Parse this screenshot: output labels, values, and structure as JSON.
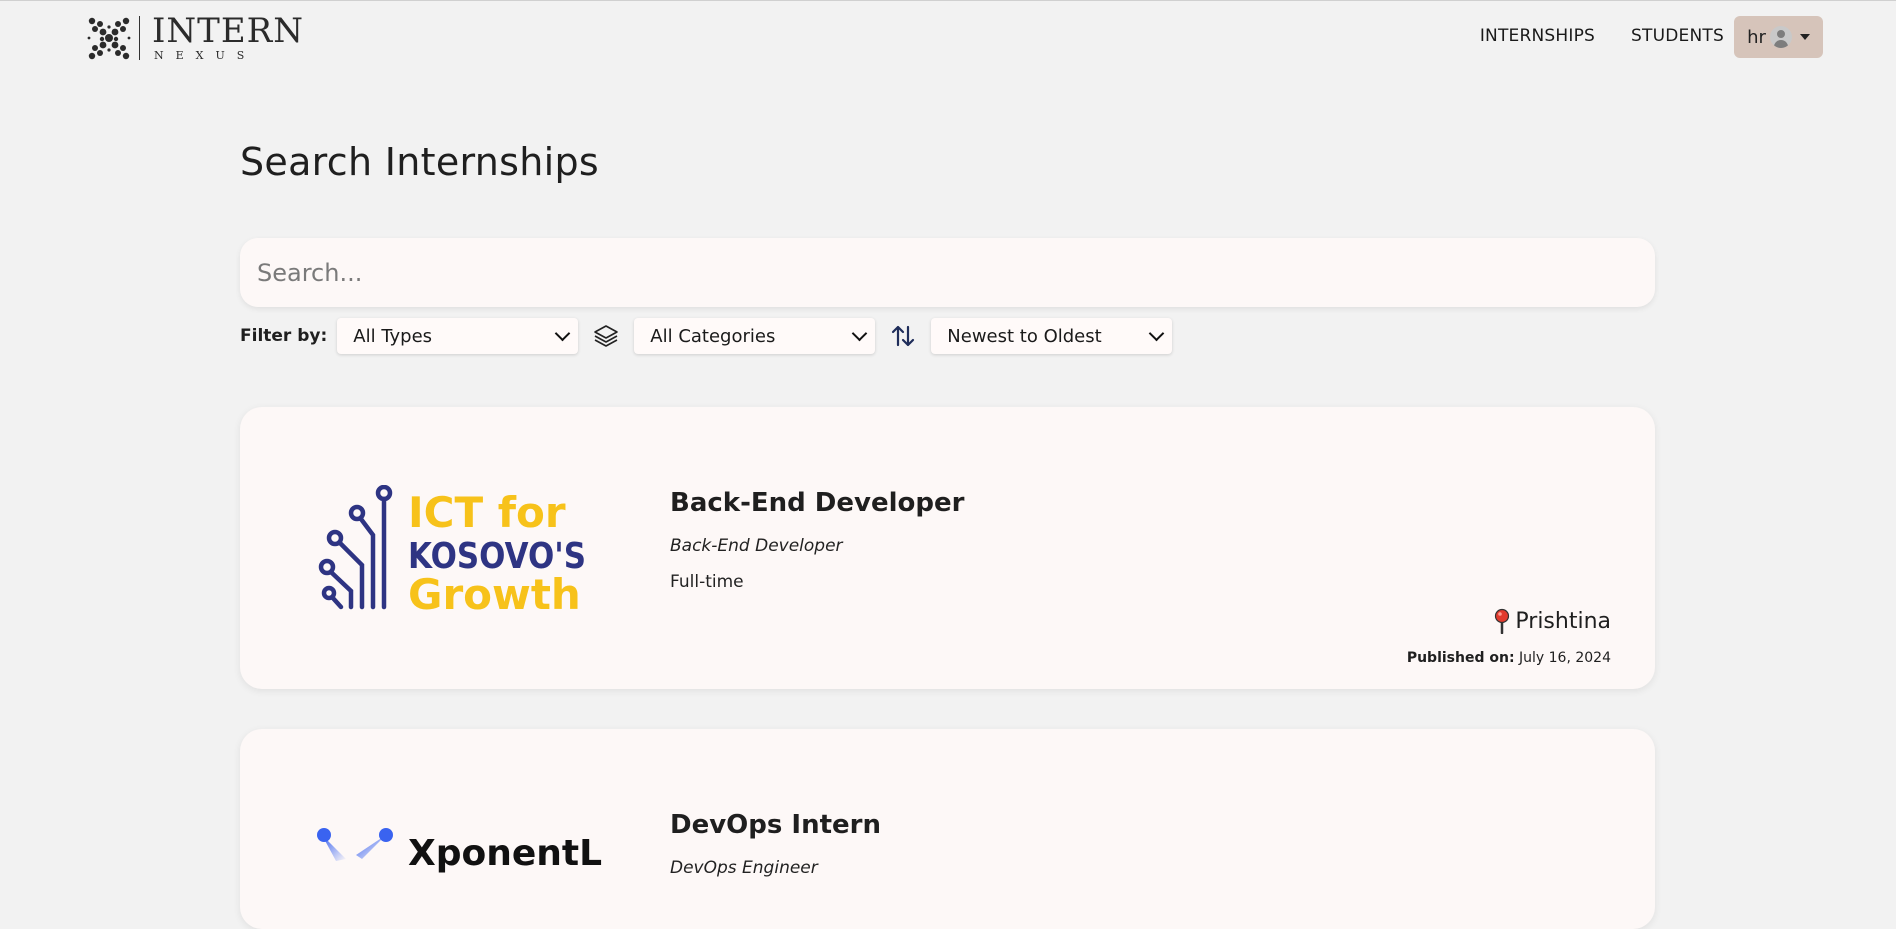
{
  "logo": {
    "main": "INTERN",
    "sub": "NEXUS"
  },
  "nav": {
    "links": [
      "INTERNSHIPS",
      "STUDENTS"
    ],
    "user_label": "hr"
  },
  "page": {
    "title": "Search Internships",
    "search_placeholder": "Search..."
  },
  "filters": {
    "label": "Filter by:",
    "type_selected": "All Types",
    "category_selected": "All Categories",
    "sort_selected": "Newest to Oldest"
  },
  "internships": [
    {
      "logo_text": [
        "ICT for",
        "KOSOVO'S",
        "Growth"
      ],
      "title": "Back-End Developer",
      "subtitle": "Back-End Developer",
      "type": "Full-time",
      "location": "Prishtina",
      "published_label": "Published on:",
      "published_date": "July 16, 2024"
    },
    {
      "logo_text": [
        "XponentL"
      ],
      "title": "DevOps Intern",
      "subtitle": "DevOps Engineer"
    }
  ],
  "colors": {
    "background": "#f2f2f2",
    "card": "#fdf8f7",
    "user_button": "#d6c4ba",
    "ict_yellow": "#f7c21a",
    "ict_navy": "#2e3483",
    "xponentl_blue": "#3a63f0"
  }
}
